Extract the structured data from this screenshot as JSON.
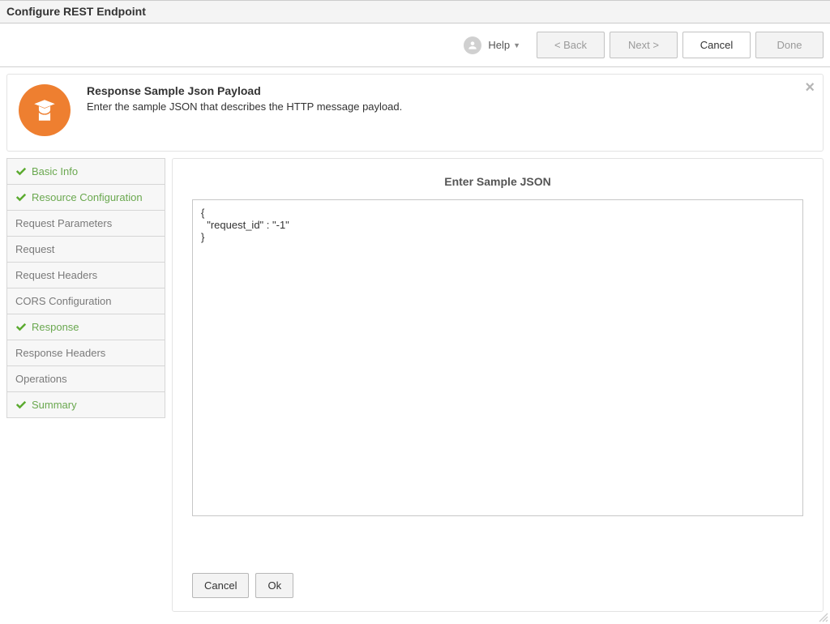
{
  "window_title": "Configure REST Endpoint",
  "toolbar": {
    "help_label": "Help",
    "back_label": "< Back",
    "next_label": "Next >",
    "cancel_label": "Cancel",
    "done_label": "Done"
  },
  "header": {
    "title": "Response Sample Json Payload",
    "subtitle": "Enter the sample JSON that describes the HTTP message payload."
  },
  "sidebar": {
    "items": [
      {
        "label": "Basic Info",
        "done": true
      },
      {
        "label": "Resource Configuration",
        "done": true
      },
      {
        "label": "Request Parameters",
        "done": false
      },
      {
        "label": "Request",
        "done": false
      },
      {
        "label": "Request Headers",
        "done": false
      },
      {
        "label": "CORS Configuration",
        "done": false
      },
      {
        "label": "Response",
        "done": true
      },
      {
        "label": "Response Headers",
        "done": false
      },
      {
        "label": "Operations",
        "done": false
      },
      {
        "label": "Summary",
        "done": true
      }
    ]
  },
  "main": {
    "section_title": "Enter Sample JSON",
    "json_value": "{\n  \"request_id\" : \"-1\"\n}",
    "cancel_label": "Cancel",
    "ok_label": "Ok"
  }
}
